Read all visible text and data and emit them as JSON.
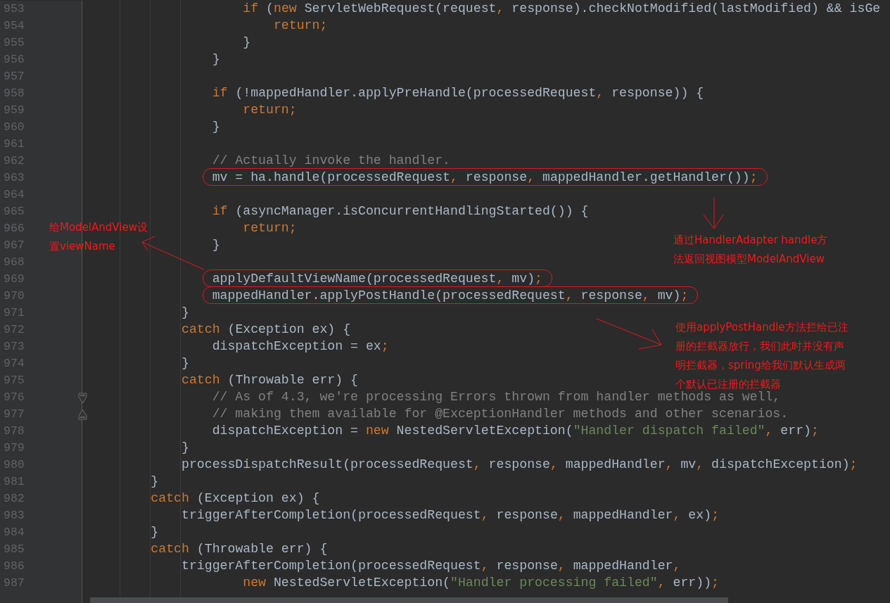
{
  "editor": {
    "lines": [
      {
        "number": "953",
        "circled": false,
        "tokens": [
          {
            "kind": "keyword",
            "text": "                    if"
          },
          " (",
          {
            "kind": "keyword",
            "text": "new"
          },
          " ServletWebRequest(request",
          {
            "kind": "punct",
            "text": ","
          },
          " response).checkNotModified(lastModified) && isGe"
        ]
      },
      {
        "number": "954",
        "circled": false,
        "tokens": [
          {
            "kind": "keyword",
            "text": "                        return"
          },
          {
            "kind": "punct",
            "text": ";"
          }
        ]
      },
      {
        "number": "955",
        "circled": false,
        "tokens": [
          "                    }"
        ]
      },
      {
        "number": "956",
        "circled": false,
        "tokens": [
          "                }"
        ]
      },
      {
        "number": "957"
      },
      {
        "number": "958",
        "circled": false,
        "tokens": [
          {
            "kind": "keyword",
            "text": "                if"
          },
          " (!mappedHandler.applyPreHandle(processedRequest",
          {
            "kind": "punct",
            "text": ","
          },
          " response)) {"
        ]
      },
      {
        "number": "959",
        "circled": false,
        "tokens": [
          {
            "kind": "keyword",
            "text": "                    return"
          },
          {
            "kind": "punct",
            "text": ";"
          }
        ]
      },
      {
        "number": "960",
        "circled": false,
        "tokens": [
          "                }"
        ]
      },
      {
        "number": "961"
      },
      {
        "number": "962",
        "circled": false,
        "tokens": [
          {
            "kind": "comment",
            "text": "                // Actually invoke the handler."
          }
        ]
      },
      {
        "number": "963",
        "circled": true,
        "tokens": [
          "                mv = ha.handle(processedRequest",
          {
            "kind": "punct",
            "text": ","
          },
          " response",
          {
            "kind": "punct",
            "text": ","
          },
          " mappedHandler.getHandler())",
          {
            "kind": "punct",
            "text": ";"
          }
        ]
      },
      {
        "number": "964"
      },
      {
        "number": "965",
        "circled": false,
        "tokens": [
          {
            "kind": "keyword",
            "text": "                if"
          },
          " (asyncManager.isConcurrentHandlingStarted()) {"
        ]
      },
      {
        "number": "966",
        "circled": false,
        "tokens": [
          {
            "kind": "keyword",
            "text": "                    return"
          },
          {
            "kind": "punct",
            "text": ";"
          }
        ]
      },
      {
        "number": "967",
        "circled": false,
        "tokens": [
          "                }"
        ]
      },
      {
        "number": "968"
      },
      {
        "number": "969",
        "circled": true,
        "tokens": [
          "                applyDefaultViewName(processedRequest",
          {
            "kind": "punct",
            "text": ","
          },
          " mv)",
          {
            "kind": "punct",
            "text": ";"
          }
        ]
      },
      {
        "number": "970",
        "circled": true,
        "tokens": [
          "                mappedHandler.applyPostHandle(processedRequest",
          {
            "kind": "punct",
            "text": ","
          },
          " response",
          {
            "kind": "punct",
            "text": ","
          },
          " mv)",
          {
            "kind": "punct",
            "text": ";"
          }
        ]
      },
      {
        "number": "971",
        "circled": false,
        "tokens": [
          "            }"
        ]
      },
      {
        "number": "972",
        "circled": false,
        "tokens": [
          {
            "kind": "keyword",
            "text": "            catch"
          },
          " (Exception ex) {"
        ]
      },
      {
        "number": "973",
        "circled": false,
        "tokens": [
          "                dispatchException = ex",
          {
            "kind": "punct",
            "text": ";"
          }
        ]
      },
      {
        "number": "974",
        "circled": false,
        "tokens": [
          "            }"
        ]
      },
      {
        "number": "975",
        "circled": false,
        "tokens": [
          {
            "kind": "keyword",
            "text": "            catch"
          },
          " (Throwable err) {"
        ]
      },
      {
        "number": "976",
        "circled": false,
        "tokens": [
          {
            "kind": "comment",
            "text": "                // As of 4.3, we're processing Errors thrown from handler methods as well,"
          }
        ]
      },
      {
        "number": "977",
        "circled": false,
        "tokens": [
          {
            "kind": "comment",
            "text": "                // making them available for @ExceptionHandler methods and other scenarios."
          }
        ]
      },
      {
        "number": "978",
        "circled": false,
        "tokens": [
          "                dispatchException = ",
          {
            "kind": "keyword",
            "text": "new"
          },
          " NestedServletException(",
          {
            "kind": "string",
            "text": "\"Handler dispatch failed\""
          },
          {
            "kind": "punct",
            "text": ","
          },
          " err)",
          {
            "kind": "punct",
            "text": ";"
          }
        ]
      },
      {
        "number": "979",
        "circled": false,
        "tokens": [
          "            }"
        ]
      },
      {
        "number": "980",
        "circled": false,
        "tokens": [
          "            processDispatchResult(processedRequest",
          {
            "kind": "punct",
            "text": ","
          },
          " response",
          {
            "kind": "punct",
            "text": ","
          },
          " mappedHandler",
          {
            "kind": "punct",
            "text": ","
          },
          " mv",
          {
            "kind": "punct",
            "text": ","
          },
          " dispatchException)",
          {
            "kind": "punct",
            "text": ";"
          }
        ]
      },
      {
        "number": "981",
        "circled": false,
        "tokens": [
          "        }"
        ]
      },
      {
        "number": "982",
        "circled": false,
        "tokens": [
          {
            "kind": "keyword",
            "text": "        catch"
          },
          " (Exception ex) {"
        ]
      },
      {
        "number": "983",
        "circled": false,
        "tokens": [
          "            triggerAfterCompletion(processedRequest",
          {
            "kind": "punct",
            "text": ","
          },
          " response",
          {
            "kind": "punct",
            "text": ","
          },
          " mappedHandler",
          {
            "kind": "punct",
            "text": ","
          },
          " ex)",
          {
            "kind": "punct",
            "text": ";"
          }
        ]
      },
      {
        "number": "984",
        "circled": false,
        "tokens": [
          "        }"
        ]
      },
      {
        "number": "985",
        "circled": false,
        "tokens": [
          {
            "kind": "keyword",
            "text": "        catch"
          },
          " (Throwable err) {"
        ]
      },
      {
        "number": "986",
        "circled": false,
        "tokens": [
          "            triggerAfterCompletion(processedRequest",
          {
            "kind": "punct",
            "text": ","
          },
          " response",
          {
            "kind": "punct",
            "text": ","
          },
          " mappedHandler",
          {
            "kind": "punct",
            "text": ","
          }
        ]
      },
      {
        "number": "987",
        "circled": false,
        "tokens": [
          {
            "kind": "keyword",
            "text": "                    new"
          },
          " NestedServletException(",
          {
            "kind": "string",
            "text": "\"Handler processing failed\""
          },
          {
            "kind": "punct",
            "text": ","
          },
          " err))",
          {
            "kind": "punct",
            "text": ";"
          }
        ]
      }
    ]
  },
  "annotations": {
    "notes": [
      {
        "lines": [
          "给ModelAndView设",
          "置viewName"
        ]
      },
      {
        "lines": [
          "通过HandlerAdapter handle方",
          "法返回视图模型ModelAndView"
        ]
      },
      {
        "lines": [
          "使用applyPostHandle方法拦给已注",
          "册的拦截器放行，我们此时并没有声",
          "明拦截器，spring给我们默认生成两",
          "个默认已注册的拦截器"
        ]
      }
    ]
  }
}
